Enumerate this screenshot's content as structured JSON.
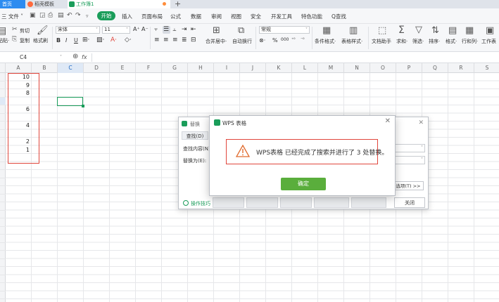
{
  "tabs": [
    {
      "label": "首页"
    },
    {
      "label": "稻壳模板"
    },
    {
      "label": "工作簿1"
    }
  ],
  "menu": {
    "file": "三 文件 ˅",
    "items": [
      "开始",
      "插入",
      "页面布局",
      "公式",
      "数据",
      "审阅",
      "视图",
      "安全",
      "开发工具",
      "特色功能"
    ],
    "search": "Q查找"
  },
  "ribbon": {
    "cut": "剪切",
    "paste": "粘贴·",
    "copy": "复制",
    "format_painter": "格式刷",
    "font": "宋体",
    "size": "11",
    "merge": "合并居中·",
    "wrap": "自动换行",
    "number_format": "常规",
    "cond_format": "条件格式·",
    "table_style": "表格样式·",
    "doc_helper": "文档助手",
    "sum": "求和·",
    "filter": "筛选·",
    "sort": "排序·",
    "format": "格式·",
    "rowcol": "行和列·",
    "worksheet": "工作表"
  },
  "formula_bar": {
    "cell_ref": "C4",
    "fx": "fx"
  },
  "columns": [
    "A",
    "B",
    "C",
    "D",
    "E",
    "F",
    "G",
    "H",
    "I",
    "J",
    "K",
    "L",
    "M",
    "N",
    "O",
    "P",
    "Q",
    "R",
    "S"
  ],
  "selected_column": "C",
  "cells": [
    {
      "row": 1,
      "value": "10"
    },
    {
      "row": 2,
      "value": "9"
    },
    {
      "row": 3,
      "value": "8"
    },
    {
      "row": 5,
      "value": "6"
    },
    {
      "row": 7,
      "value": "4"
    },
    {
      "row": 9,
      "value": "2"
    },
    {
      "row": 10,
      "value": "1"
    }
  ],
  "find_dialog": {
    "title": "替换",
    "tab_find": "查找(D)",
    "find_label": "查找内容(N)",
    "replace_label": "替换为(E):",
    "options": "选项(T) >>",
    "tips": "操作技巧",
    "close": "关闭"
  },
  "alert": {
    "title": "WPS 表格",
    "message": "WPS表格 已经完成了搜索并进行了 3 处替换。",
    "ok": "确定"
  },
  "colors": {
    "accent": "#1a9d5a",
    "highlight": "#e0463c",
    "ok": "#5aae3c"
  }
}
